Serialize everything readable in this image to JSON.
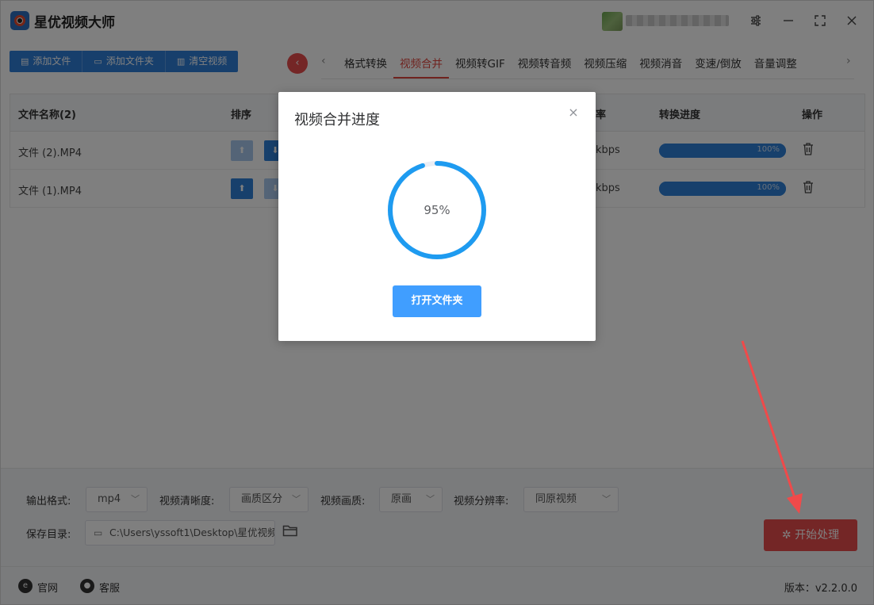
{
  "app": {
    "title": "星优视频大师"
  },
  "toolbar": {
    "add_file": "添加文件",
    "add_folder": "添加文件夹",
    "clear": "清空视频"
  },
  "tabs": [
    {
      "label": "格式转换",
      "active": false
    },
    {
      "label": "视频合并",
      "active": true
    },
    {
      "label": "视频转GIF",
      "active": false
    },
    {
      "label": "视频转音频",
      "active": false
    },
    {
      "label": "视频压缩",
      "active": false
    },
    {
      "label": "视频消音",
      "active": false
    },
    {
      "label": "变速/倒放",
      "active": false
    },
    {
      "label": "音量调整",
      "active": false
    }
  ],
  "table": {
    "headers": {
      "name": "文件名称(2)",
      "sort": "排序",
      "bitrate": "率",
      "progress": "转换进度",
      "actions": "操作"
    },
    "rows": [
      {
        "name": "文件 (2).MP4",
        "bitrate": "kbps",
        "progress": 100,
        "progress_text": "100%"
      },
      {
        "name": "文件 (1).MP4",
        "bitrate": "kbps",
        "progress": 100,
        "progress_text": "100%"
      }
    ]
  },
  "settings": {
    "format_label": "输出格式:",
    "format_value": "mp4",
    "clarity_label": "视频清晰度:",
    "clarity_value": "画质区分",
    "quality_label": "视频画质:",
    "quality_value": "原画",
    "resolution_label": "视频分辨率:",
    "resolution_value": "同原视频",
    "save_label": "保存目录:",
    "save_path": "C:\\Users\\yssoft1\\Desktop\\星优视频"
  },
  "start_button": "开始处理",
  "footer": {
    "website": "官网",
    "support": "客服",
    "version": "版本：v2.2.0.0"
  },
  "dialog": {
    "title": "视频合并进度",
    "progress": 0.95,
    "progress_text": "95%",
    "open_folder": "打开文件夹"
  },
  "colors": {
    "primary_blue": "#2f80d8",
    "accent_red": "#e0473f",
    "dialog_button": "#409eff",
    "ring": "#1e9bf0",
    "ring_track": "#ebeef5"
  }
}
